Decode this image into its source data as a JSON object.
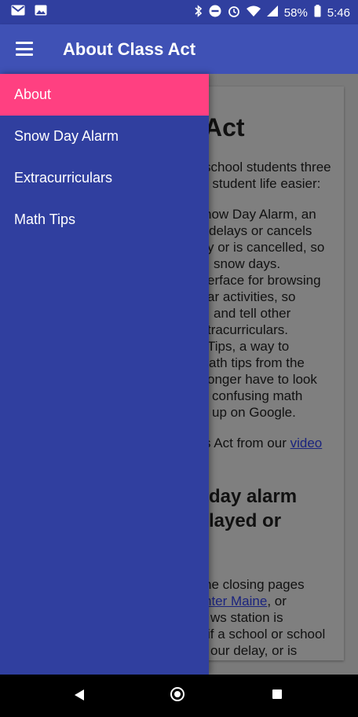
{
  "status_bar": {
    "battery": "58%",
    "time": "5:46",
    "icons": [
      "gmail-icon",
      "image-icon",
      "bluetooth-icon",
      "do-not-disturb-icon",
      "alarm-icon",
      "wifi-icon",
      "signal-icon",
      "battery-icon"
    ]
  },
  "app_bar": {
    "title": "About Class Act",
    "menu_icon": "hamburger-menu-icon"
  },
  "drawer": {
    "items": [
      {
        "label": "About",
        "active": true
      },
      {
        "label": "Snow Day Alarm",
        "active": false
      },
      {
        "label": "Extracurriculars",
        "active": false
      },
      {
        "label": "Math Tips",
        "active": false
      }
    ]
  },
  "content": {
    "heading": "Act",
    "intro_line1": "school students three",
    "intro_line2": "r student life easier:",
    "list_lines": [
      "now Day Alarm, an",
      "delays or cancels",
      "y or is cancelled, so",
      "snow days.",
      "erface for browsing",
      "ar activities, so",
      "and tell other",
      "tracurriculars.",
      "Tips, a way to",
      "ath tips from the",
      "onger have to look",
      "confusing math",
      "up on Google."
    ],
    "video_text": "s Act from our",
    "video_link": "video",
    "section_heading_line1": "day alarm",
    "section_heading_line2": "layed or",
    "closing_line1": "he closing pages",
    "closing_link": "nter Maine",
    "closing_line2_suffix": ", or",
    "closing_line3": "ws station is",
    "closing_line4": "if a school or school",
    "closing_line5": "our delay, or is"
  },
  "colors": {
    "primary": "#3f51b5",
    "primary_dark": "#303f9f",
    "accent": "#ff4081"
  }
}
